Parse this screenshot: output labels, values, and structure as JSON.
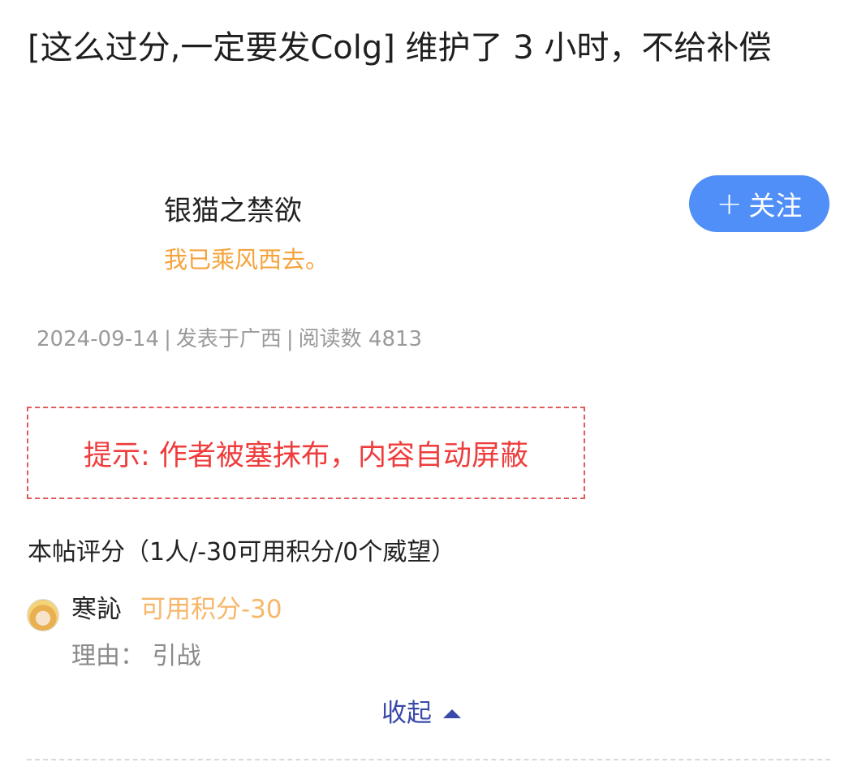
{
  "post": {
    "title": "[这么过分,一定要发Colg] 维护了 3 小时，不给补偿"
  },
  "author": {
    "name": "银猫之禁欲",
    "signature": "我已乘风西去。",
    "follow_icon": "plus-icon",
    "follow_label": "关注"
  },
  "meta": {
    "date": "2024-09-14",
    "separator": "|",
    "location": "发表于广西",
    "reads": "阅读数 4813"
  },
  "notice": {
    "text": "提示: 作者被塞抹布，内容自动屏蔽"
  },
  "rating": {
    "title": "本帖评分（1人/-30可用积分/0个威望）",
    "entries": [
      {
        "avatar_icon": "avatar-image",
        "user": "寒訫",
        "score": "可用积分-30",
        "reason": "理由：  引战"
      }
    ],
    "collapse_label": "收起",
    "collapse_icon": "caret-up-icon"
  },
  "colors": {
    "accent_blue": "#4f8ff7",
    "signature_orange": "#f5a33b",
    "notice_red": "#ef3c3c",
    "score_orange": "#f7b66a",
    "link_blue": "#3a4aa8"
  }
}
